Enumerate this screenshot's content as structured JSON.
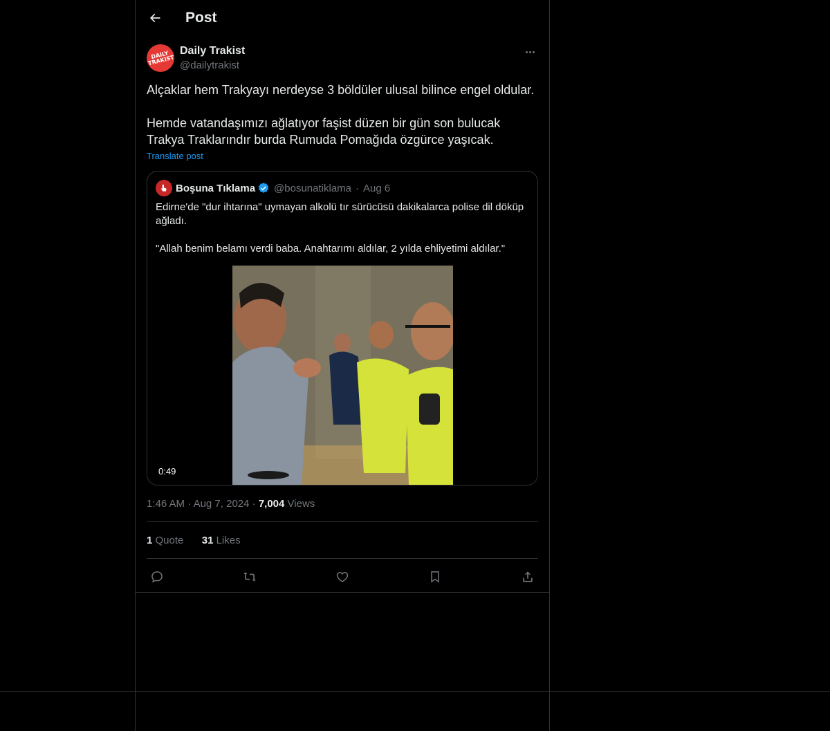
{
  "header": {
    "title": "Post"
  },
  "post": {
    "author_name": "Daily Trakist",
    "author_handle": "@dailytrakist",
    "avatar_text": "DAILY TRAKIST",
    "text": "Alçaklar hem Trakyayı nerdeyse 3 böldüler ulusal bilince engel oldular.\n\nHemde vatandaşımızı ağlatıyor faşist düzen bir gün son bulucak Trakya Traklarındır burda Rumuda Pomağıda özgürce yaşıcak.",
    "translate_label": "Translate post",
    "time": "1:46 AM",
    "date": "Aug 7, 2024",
    "views_count": "7,004",
    "views_label": "Views",
    "quote_count": "1",
    "quote_label": "Quote",
    "likes_count": "31",
    "likes_label": "Likes"
  },
  "quoted": {
    "author_name": "Boşuna Tıklama",
    "author_handle": "@bosunatiklama",
    "date": "Aug 6",
    "text": "Edirne'de \"dur ihtarına\" uymayan alkolü tır sürücüsü dakikalarca polise dil döküp ağladı.\n\n\"Allah benim belamı verdi baba. Anahtarımı aldılar, 2 yılda ehliyetimi aldılar.\"",
    "video_duration": "0:49"
  },
  "actions": {
    "reply_icon": "reply-icon",
    "repost_icon": "repost-icon",
    "like_icon": "heart-icon",
    "bookmark_icon": "bookmark-icon",
    "share_icon": "share-icon"
  },
  "colors": {
    "background": "#000000",
    "text": "#e7e9ea",
    "muted": "#71767b",
    "accent": "#1d9bf0",
    "border": "#2f3336",
    "verified": "#1d9bf0",
    "avatar_brand": "#e53935"
  }
}
